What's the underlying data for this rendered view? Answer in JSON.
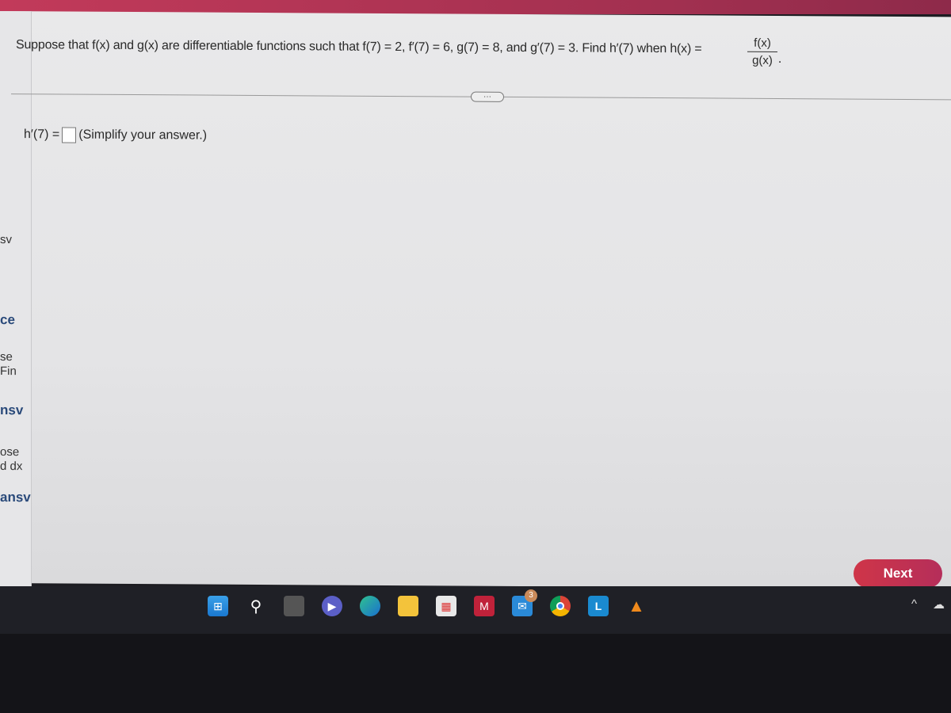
{
  "question": {
    "text": "Suppose that f(x) and g(x) are differentiable functions such that f(7) = 2, f′(7) = 6, g(7) = 8, and g′(7) = 3. Find h′(7) when h(x) =",
    "fraction_numerator": "f(x)",
    "fraction_denominator": "g(x)",
    "period": "."
  },
  "more_button": "···",
  "answer": {
    "label": "h′(7) =",
    "value": "",
    "hint": "(Simplify your answer.)"
  },
  "next_label": "Next",
  "left_fragments": [
    "sv",
    "ce",
    "se",
    "Fin",
    "nsv",
    "ose",
    "d dx",
    "ansv"
  ],
  "taskbar": {
    "icons": [
      "windows-start",
      "search",
      "task-view",
      "teams-meet",
      "edge",
      "file-explorer",
      "microsoft-store",
      "mcafee",
      "mail",
      "chrome",
      "l-app",
      "vlc"
    ],
    "mail_badge": "3"
  },
  "colors": {
    "accent": "#c23a5a",
    "next_button": "#cf3548"
  }
}
